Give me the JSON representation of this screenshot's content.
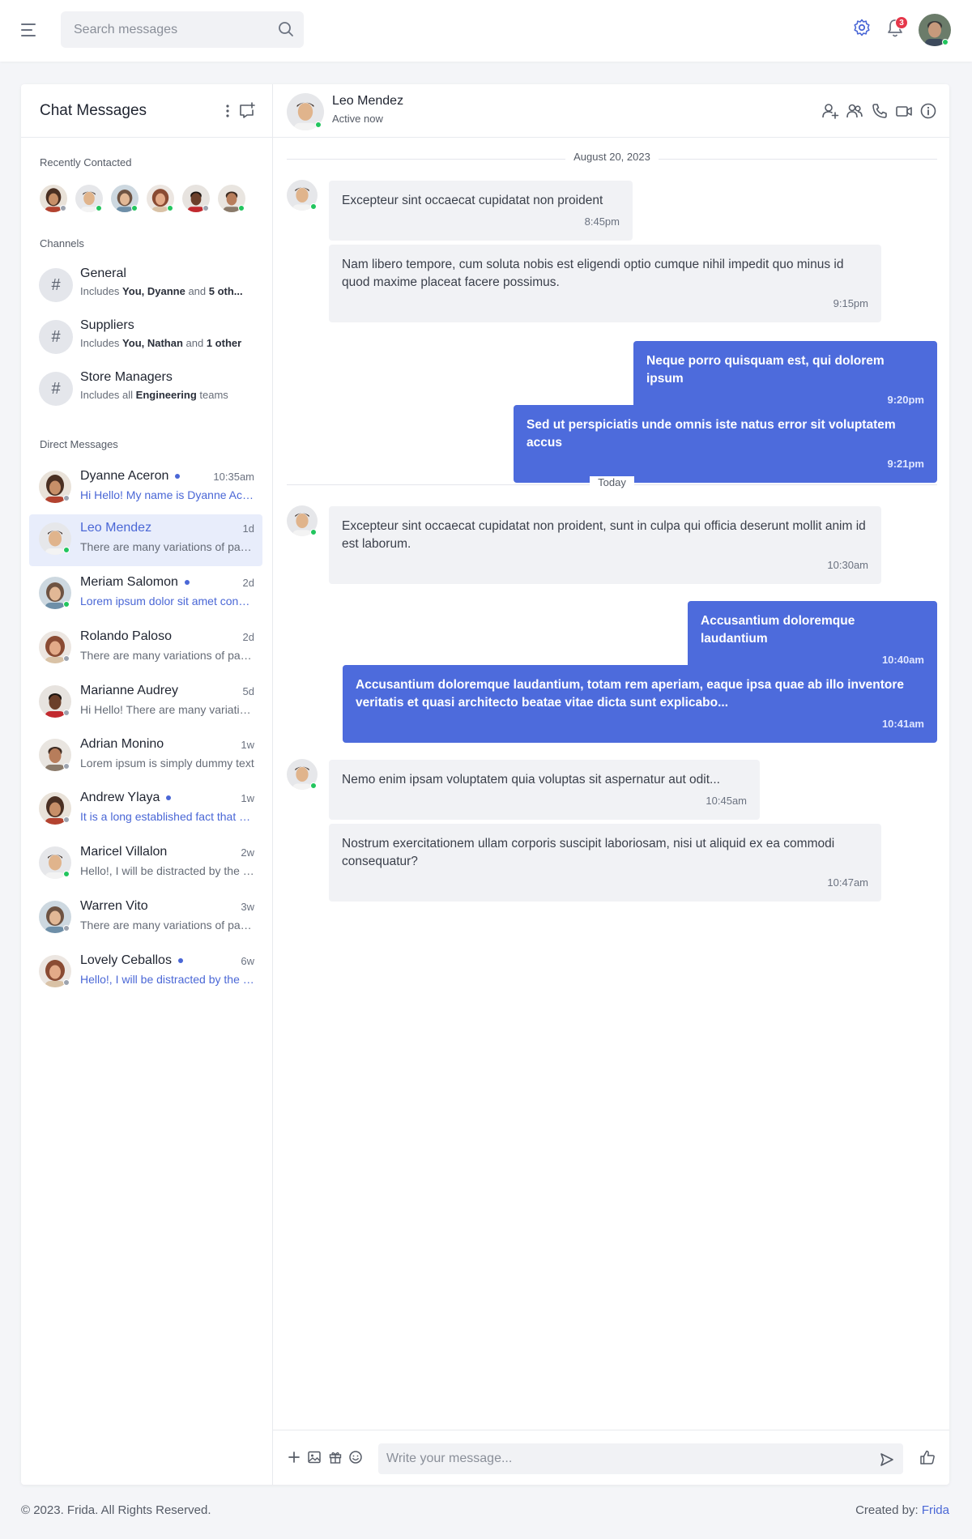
{
  "topbar": {
    "search_placeholder": "Search messages",
    "notification_count": "3"
  },
  "colors": {
    "accent": "#4d6bdc",
    "online": "#22c55e",
    "badge": "#e5374a"
  },
  "icons": {
    "menu": "hamburger-icon",
    "search": "search-icon",
    "settings": "gear-icon",
    "notifications": "bell-icon",
    "more": "kebab-icon",
    "compose": "compose-icon",
    "add_user": "add-user-icon",
    "group": "group-icon",
    "call": "phone-icon",
    "video": "video-icon",
    "info": "info-icon",
    "attach": "plus-icon",
    "image": "image-icon",
    "gift": "gift-icon",
    "emoji": "emoji-icon",
    "send": "send-icon",
    "like": "thumbs-up-icon"
  },
  "sidebar": {
    "title": "Chat Messages",
    "recent_label": "Recently Contacted",
    "channels_label": "Channels",
    "dm_label": "Direct Messages",
    "channels": [
      {
        "name": "General",
        "sub_pre": "Includes ",
        "sub_bold": "You, Dyanne",
        "sub_mid": " and ",
        "sub_bold2": "5 oth..."
      },
      {
        "name": "Suppliers",
        "sub_pre": "Includes ",
        "sub_bold": "You, Nathan",
        "sub_mid": " and ",
        "sub_bold2": "1 other"
      },
      {
        "name": "Store Managers",
        "sub_pre": "Includes all ",
        "sub_bold": "Engineering",
        "sub_mid": " teams",
        "sub_bold2": ""
      }
    ],
    "direct_messages": [
      {
        "name": "Dyanne Aceron",
        "time": "10:35am",
        "preview": "Hi Hello! My name is Dyanne Aceron",
        "unread": true
      },
      {
        "name": "Leo Mendez",
        "time": "1d",
        "preview": "There are many variations of passages",
        "unread": false
      },
      {
        "name": "Meriam Salomon",
        "time": "2d",
        "preview": "Lorem ipsum dolor sit amet consectetur",
        "unread": true
      },
      {
        "name": "Rolando Paloso",
        "time": "2d",
        "preview": "There are many variations of passages",
        "unread": false
      },
      {
        "name": "Marianne Audrey",
        "time": "5d",
        "preview": "Hi Hello! There are many variations",
        "unread": false
      },
      {
        "name": "Adrian Monino",
        "time": "1w",
        "preview": "Lorem ipsum is simply dummy text",
        "unread": false
      },
      {
        "name": "Andrew Ylaya",
        "time": "1w",
        "preview": "It is a long established fact that a reader",
        "unread": true
      },
      {
        "name": "Maricel Villalon",
        "time": "2w",
        "preview": "Hello!, I will be distracted by the readable",
        "unread": false
      },
      {
        "name": "Warren Vito",
        "time": "3w",
        "preview": "There are many variations of passages",
        "unread": false
      },
      {
        "name": "Lovely Ceballos",
        "time": "6w",
        "preview": "Hello!, I will be distracted by the readable",
        "unread": true
      }
    ]
  },
  "chat": {
    "name": "Leo Mendez",
    "status": "Active now",
    "dividers": [
      "August 20, 2023",
      "Today"
    ],
    "messages": [
      {
        "text": "Excepteur sint occaecat cupidatat non proident",
        "time": "8:45pm"
      },
      {
        "text": "Nam libero tempore, cum soluta nobis est eligendi optio cumque nihil impedit quo minus id quod maxime placeat facere possimus.",
        "time": "9:15pm"
      },
      {
        "text": "Neque porro quisquam est, qui dolorem ipsum",
        "time": "9:20pm"
      },
      {
        "text": "Sed ut perspiciatis unde omnis iste natus error sit voluptatem accus",
        "time": "9:21pm"
      },
      {
        "text": "Excepteur sint occaecat cupidatat non proident, sunt in culpa qui officia deserunt mollit anim id est laborum.",
        "time": "10:30am"
      },
      {
        "text": "Accusantium doloremque laudantium",
        "time": "10:40am"
      },
      {
        "text": "Accusantium doloremque laudantium, totam rem aperiam, eaque ipsa quae ab illo inventore veritatis et quasi architecto beatae vitae dicta sunt explicabo...",
        "time": "10:41am"
      },
      {
        "text": "Nemo enim ipsam voluptatem quia voluptas sit aspernatur aut odit...",
        "time": "10:45am"
      },
      {
        "text": "Nostrum exercitationem ullam corporis suscipit laboriosam, nisi ut aliquid ex ea commodi consequatur?",
        "time": "10:47am"
      }
    ],
    "composer_placeholder": "Write your message..."
  },
  "footer": {
    "copyright": "© 2023. Frida. All Rights Reserved.",
    "created_by": "Created by: ",
    "author": "Frida"
  }
}
